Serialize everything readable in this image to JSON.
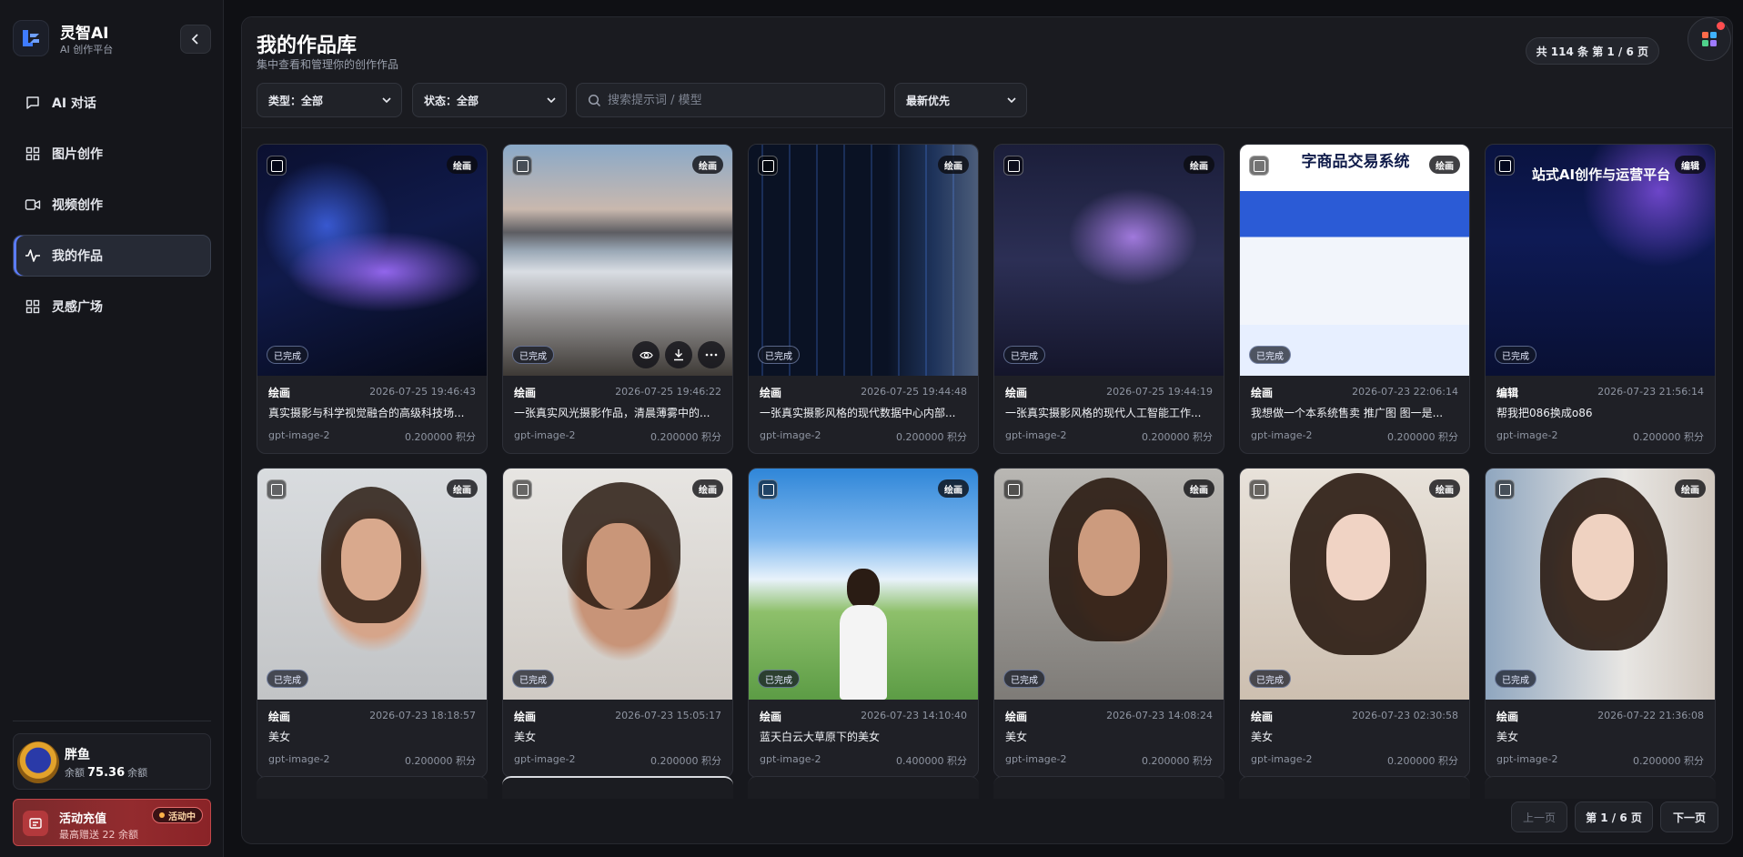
{
  "app": {
    "name": "灵智AI",
    "subtitle": "AI 创作平台"
  },
  "sidebar": {
    "items": [
      {
        "label": "AI 对话",
        "icon": "chat-icon",
        "active": false
      },
      {
        "label": "图片创作",
        "icon": "grid-icon",
        "active": false
      },
      {
        "label": "视频创作",
        "icon": "video-icon",
        "active": false
      },
      {
        "label": "我的作品",
        "icon": "activity-icon",
        "active": true
      },
      {
        "label": "灵感广场",
        "icon": "grid-icon",
        "active": false
      }
    ]
  },
  "user": {
    "name": "胖鱼",
    "balance_prefix": "余额",
    "balance": "75.36",
    "balance_suffix": "余额"
  },
  "promo": {
    "title": "活动充值",
    "subtitle": "最高赠送 22 余额",
    "badge": "活动中"
  },
  "page": {
    "title": "我的作品库",
    "subtitle": "集中查看和管理你的创作作品",
    "count_label": "共 114 条  第 1 / 6 页"
  },
  "filters": {
    "type": "类型：全部",
    "status": "状态：全部",
    "search_placeholder": "搜索提示词 / 模型",
    "sort": "最新优先"
  },
  "cards": [
    {
      "tag": "绘画",
      "status": "已完成",
      "type": "绘画",
      "date": "2026-07-25 19:46:43",
      "prompt": "真实摄影与科学视觉融合的高级科技场...",
      "model": "gpt-image-2",
      "cost": "0.200000 积分"
    },
    {
      "tag": "绘画",
      "status": "已完成",
      "type": "绘画",
      "date": "2026-07-25 19:46:22",
      "prompt": "一张真实风光摄影作品，清晨薄雾中的...",
      "model": "gpt-image-2",
      "cost": "0.200000 积分"
    },
    {
      "tag": "绘画",
      "status": "已完成",
      "type": "绘画",
      "date": "2026-07-25 19:44:48",
      "prompt": "一张真实摄影风格的现代数据中心内部...",
      "model": "gpt-image-2",
      "cost": "0.200000 积分"
    },
    {
      "tag": "绘画",
      "status": "已完成",
      "type": "绘画",
      "date": "2026-07-25 19:44:19",
      "prompt": "一张真实摄影风格的现代人工智能工作...",
      "model": "gpt-image-2",
      "cost": "0.200000 积分"
    },
    {
      "tag": "绘画",
      "status": "已完成",
      "type": "绘画",
      "date": "2026-07-23 22:06:14",
      "prompt": "我想做一个本系统售卖 推广图 图一是...",
      "model": "gpt-image-2",
      "cost": "0.200000 积分",
      "overlay": "字商品交易系统"
    },
    {
      "tag": "编辑",
      "status": "已完成",
      "type": "编辑",
      "date": "2026-07-23 21:56:14",
      "prompt": "帮我把086换成o86",
      "model": "gpt-image-2",
      "cost": "0.200000 积分",
      "overlay": "站式AI创作与运营平台"
    },
    {
      "tag": "绘画",
      "status": "已完成",
      "type": "绘画",
      "date": "2026-07-23 18:18:57",
      "prompt": "美女",
      "model": "gpt-image-2",
      "cost": "0.200000 积分"
    },
    {
      "tag": "绘画",
      "status": "已完成",
      "type": "绘画",
      "date": "2026-07-23 15:05:17",
      "prompt": "美女",
      "model": "gpt-image-2",
      "cost": "0.200000 积分"
    },
    {
      "tag": "绘画",
      "status": "已完成",
      "type": "绘画",
      "date": "2026-07-23 14:10:40",
      "prompt": "蓝天白云大草原下的美女",
      "model": "gpt-image-2",
      "cost": "0.400000 积分"
    },
    {
      "tag": "绘画",
      "status": "已完成",
      "type": "绘画",
      "date": "2026-07-23 14:08:24",
      "prompt": "美女",
      "model": "gpt-image-2",
      "cost": "0.200000 积分"
    },
    {
      "tag": "绘画",
      "status": "已完成",
      "type": "绘画",
      "date": "2026-07-23 02:30:58",
      "prompt": "美女",
      "model": "gpt-image-2",
      "cost": "0.200000 积分"
    },
    {
      "tag": "绘画",
      "status": "已完成",
      "type": "绘画",
      "date": "2026-07-22 21:36:08",
      "prompt": "美女",
      "model": "gpt-image-2",
      "cost": "0.200000 积分"
    }
  ],
  "pagination": {
    "prev": "上一页",
    "current": "第 1 / 6 页",
    "next": "下一页"
  },
  "colors": {
    "accent": "#5b7cff",
    "promo": "#932b2e",
    "background": "#0f1014"
  }
}
